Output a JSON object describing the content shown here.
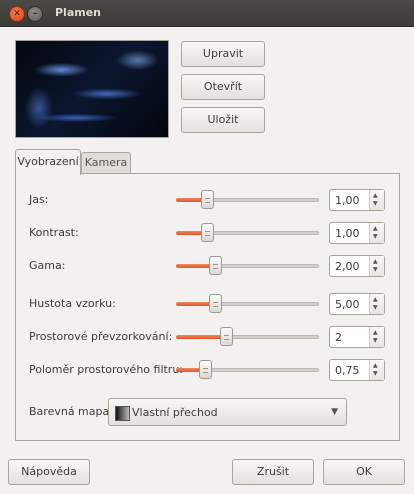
{
  "window": {
    "title": "Plamen"
  },
  "preview": {
    "icon": "flame-preview-image"
  },
  "buttons": {
    "edit": "Upravit",
    "open": "Otevřít",
    "save": "Uložit"
  },
  "tabs": [
    {
      "label": "Vyobrazení",
      "active": true
    },
    {
      "label": "Kamera",
      "active": false
    }
  ],
  "params": [
    {
      "label": "Jas:",
      "value": "1,00",
      "level": 0.22
    },
    {
      "label": "Kontrast:",
      "value": "1,00",
      "level": 0.22
    },
    {
      "label": "Gama:",
      "value": "2,00",
      "level": 0.27
    },
    {
      "label": "Hustota vzorku:",
      "value": "5,00",
      "level": 0.27
    },
    {
      "label": "Prostorové převzorkování:",
      "value": "2",
      "level": 0.35
    },
    {
      "label": "Poloměr prostorového filtru:",
      "value": "0,75",
      "level": 0.2
    }
  ],
  "colormap": {
    "label": "Barevná mapa:",
    "value": "Vlastní přechod"
  },
  "footer": {
    "help": "Nápověda",
    "cancel": "Zrušit",
    "ok": "OK"
  }
}
